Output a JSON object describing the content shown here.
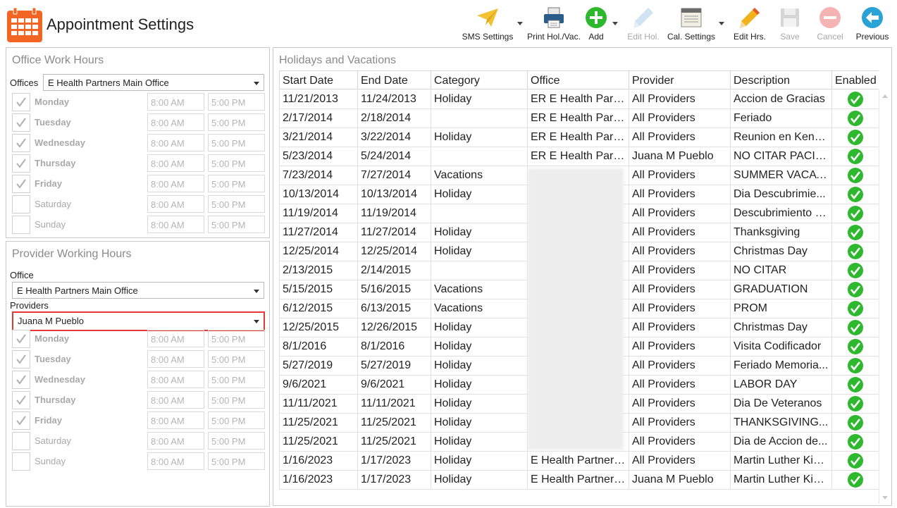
{
  "app": {
    "title": "Appointment Settings"
  },
  "toolbar": [
    {
      "label": "SMS Settings",
      "icon": "paper-plane-icon",
      "disabled": false,
      "caret": true
    },
    {
      "label": "Print Hol./Vac.",
      "icon": "printer-icon",
      "disabled": false,
      "caret": false
    },
    {
      "label": "Add",
      "icon": "add-circle-icon",
      "disabled": false,
      "caret": true
    },
    {
      "label": "Edit Hol.",
      "icon": "pencil-icon",
      "disabled": true,
      "caret": false
    },
    {
      "label": "Cal. Settings",
      "icon": "calendar-settings-icon",
      "disabled": false,
      "caret": true
    },
    {
      "label": "Edit Hrs.",
      "icon": "pencil-icon",
      "disabled": false,
      "caret": false
    },
    {
      "label": "Save",
      "icon": "save-icon",
      "disabled": true,
      "caret": false
    },
    {
      "label": "Cancel",
      "icon": "cancel-icon",
      "disabled": true,
      "caret": false
    },
    {
      "label": "Previous",
      "icon": "back-arrow-icon",
      "disabled": false,
      "caret": false
    }
  ],
  "office_hours": {
    "title": "Office Work Hours",
    "offices_label": "Offices",
    "office_value": "E Health Partners Main Office",
    "days": [
      {
        "name": "Monday",
        "checked": true,
        "start": "8:00 AM",
        "end": "5:00 PM"
      },
      {
        "name": "Tuesday",
        "checked": true,
        "start": "8:00 AM",
        "end": "5:00 PM"
      },
      {
        "name": "Wednesday",
        "checked": true,
        "start": "8:00 AM",
        "end": "5:00 PM"
      },
      {
        "name": "Thursday",
        "checked": true,
        "start": "8:00 AM",
        "end": "5:00 PM"
      },
      {
        "name": "Friday",
        "checked": true,
        "start": "8:00 AM",
        "end": "5:00 PM"
      },
      {
        "name": "Saturday",
        "checked": false,
        "start": "8:00 AM",
        "end": "5:00 PM"
      },
      {
        "name": "Sunday",
        "checked": false,
        "start": "8:00 AM",
        "end": "5:00 PM"
      }
    ]
  },
  "provider_hours": {
    "title": "Provider Working Hours",
    "office_label": "Office",
    "office_value": "E Health Partners Main Office",
    "providers_label": "Providers",
    "provider_value": "Juana M Pueblo",
    "days": [
      {
        "name": "Monday",
        "checked": true,
        "start": "8:00 AM",
        "end": "5:00 PM"
      },
      {
        "name": "Tuesday",
        "checked": true,
        "start": "8:00 AM",
        "end": "5:00 PM"
      },
      {
        "name": "Wednesday",
        "checked": true,
        "start": "8:00 AM",
        "end": "5:00 PM"
      },
      {
        "name": "Thursday",
        "checked": true,
        "start": "8:00 AM",
        "end": "5:00 PM"
      },
      {
        "name": "Friday",
        "checked": true,
        "start": "8:00 AM",
        "end": "5:00 PM"
      },
      {
        "name": "Saturday",
        "checked": false,
        "start": "8:00 AM",
        "end": "5:00 PM"
      },
      {
        "name": "Sunday",
        "checked": false,
        "start": "8:00 AM",
        "end": "5:00 PM"
      }
    ]
  },
  "holidays": {
    "title": "Holidays and Vacations",
    "columns": [
      "Start Date",
      "End Date",
      "Category",
      "Office",
      "Provider",
      "Description",
      "Enabled"
    ],
    "rows": [
      [
        "11/21/2013",
        "11/24/2013",
        "Holiday",
        "ER E Health Partn...",
        "All Providers",
        "Accion de Gracias",
        true
      ],
      [
        "2/17/2014",
        "2/18/2014",
        "",
        "ER E Health Partn...",
        "All Providers",
        "Feriado",
        true
      ],
      [
        "3/21/2014",
        "3/22/2014",
        "Holiday",
        "ER E Health Partn...",
        "All Providers",
        "Reunion en Kenn...",
        true
      ],
      [
        "5/23/2014",
        "5/24/2014",
        "",
        "ER E Health Partn...",
        "Juana M Pueblo",
        "NO CITAR PACIET...",
        true
      ],
      [
        "7/23/2014",
        "7/27/2014",
        "Vacations",
        "",
        "All Providers",
        "SUMMER VACATI...",
        true
      ],
      [
        "10/13/2014",
        "10/13/2014",
        "Holiday",
        "",
        "All Providers",
        "Dia Descubrimie...",
        true
      ],
      [
        "11/19/2014",
        "11/19/2014",
        "",
        "",
        "All Providers",
        "Descubrimiento PR",
        true
      ],
      [
        "11/27/2014",
        "11/27/2014",
        "Holiday",
        "",
        "All Providers",
        "Thanksgiving",
        true
      ],
      [
        "12/25/2014",
        "12/25/2014",
        "Holiday",
        "",
        "All Providers",
        "Christmas Day",
        true
      ],
      [
        "2/13/2015",
        "2/14/2015",
        "",
        "",
        "All Providers",
        "NO CITAR",
        true
      ],
      [
        "5/15/2015",
        "5/16/2015",
        "Vacations",
        "",
        "All Providers",
        "GRADUATION",
        true
      ],
      [
        "6/12/2015",
        "6/13/2015",
        "Vacations",
        "",
        "All Providers",
        "PROM",
        true
      ],
      [
        "12/25/2015",
        "12/26/2015",
        "Holiday",
        "",
        "All Providers",
        "Christmas Day",
        true
      ],
      [
        "8/1/2016",
        "8/1/2016",
        "Holiday",
        "",
        "All Providers",
        "Visita Codificador",
        true
      ],
      [
        "5/27/2019",
        "5/27/2019",
        "Holiday",
        "",
        "All Providers",
        "Feriado Memoria...",
        true
      ],
      [
        "9/6/2021",
        "9/6/2021",
        "Holiday",
        "",
        "All Providers",
        "LABOR DAY",
        true
      ],
      [
        "11/11/2021",
        "11/11/2021",
        "Holiday",
        "",
        "All Providers",
        "Dia De Veteranos",
        true
      ],
      [
        "11/25/2021",
        "11/25/2021",
        "Holiday",
        "",
        "All Providers",
        "THANKSGIVING...",
        true
      ],
      [
        "11/25/2021",
        "11/25/2021",
        "Holiday",
        "",
        "All Providers",
        "Dia de Accion de...",
        true
      ],
      [
        "1/16/2023",
        "1/17/2023",
        "Holiday",
        "E Health Partners...",
        "All Providers",
        "Martin Luther Kin...",
        true
      ],
      [
        "1/16/2023",
        "1/17/2023",
        "Holiday",
        "E Health Partners...",
        "Juana M Pueblo",
        "Martin Luther Kin...",
        true
      ]
    ]
  },
  "colors": {
    "accent": "#f26522",
    "check_green": "#2eb82e",
    "highlight_red": "#e53935"
  }
}
